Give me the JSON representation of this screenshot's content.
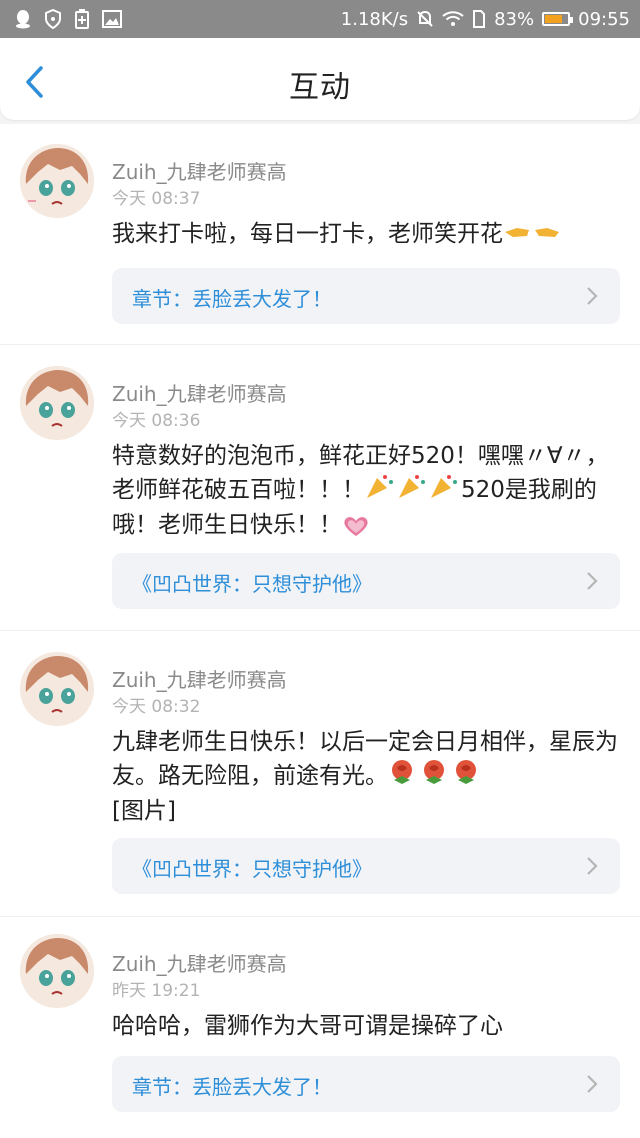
{
  "status_bar": {
    "speed": "1.18K/s",
    "battery": "83%",
    "battery_level": 0.83,
    "time": "09:55"
  },
  "header": {
    "title": "互动"
  },
  "comments": [
    {
      "username": "Zuih_九肆老师赛高",
      "time": "今天 08:37",
      "text_parts": [
        "我来打卡啦，每日一打卡，老师笑开花"
      ],
      "chapter": "章节：丢脸丢大发了！"
    },
    {
      "username": "Zuih_九肆老师赛高",
      "time": "今天 08:36",
      "text_parts": [
        "特意数好的泡泡币，鲜花正好520！嘿嘿〃∀〃，老师鲜花破五百啦！！！",
        "520是我刷的哦！老师生日快乐！！"
      ],
      "chapter": "《凹凸世界：只想守护他》"
    },
    {
      "username": "Zuih_九肆老师赛高",
      "time": "今天 08:32",
      "text_parts": [
        "九肆老师生日快乐！以后一定会日月相伴，星辰为友。路无险阻，前途有光。",
        "[图片]"
      ],
      "chapter": "《凹凸世界：只想守护他》"
    },
    {
      "username": "Zuih_九肆老师赛高",
      "time": "昨天 19:21",
      "text_parts": [
        "哈哈哈，雷狮作为大哥可谓是操碎了心"
      ],
      "chapter": "章节：丢脸丢大发了！"
    }
  ],
  "icons": {
    "back": "chevron-left-icon",
    "chapter_arrow": "chevron-right-icon",
    "clap": "clapping-hands-icon",
    "party": "party-popper-icon",
    "heart": "heart-icon",
    "rose": "rose-icon"
  },
  "colors": {
    "accent": "#2e8fd8",
    "status_bar": "#8a8a8a",
    "battery": "#f3a21f"
  }
}
